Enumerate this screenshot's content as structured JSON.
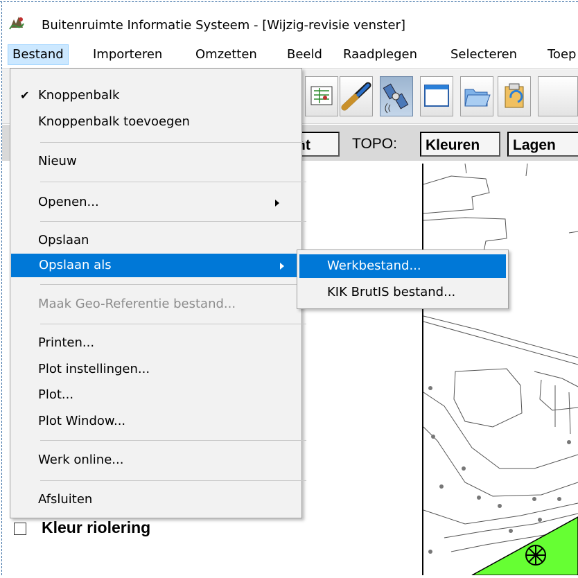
{
  "window": {
    "title": "Buitenruimte Informatie Systeem - [Wijzig-revisie venster]"
  },
  "menubar": {
    "items": [
      {
        "label": "Bestand",
        "active": true
      },
      {
        "label": "Importeren"
      },
      {
        "label": "Omzetten"
      },
      {
        "label": "Beeld"
      },
      {
        "label": "Raadplegen"
      },
      {
        "label": "Selecteren"
      },
      {
        "label": "Toep"
      }
    ]
  },
  "toolbar": {
    "icons": [
      "layers-icon",
      "pipe-icon",
      "satellite-icon",
      "window-icon",
      "open-folder-icon",
      "clipboard-icon"
    ],
    "segment_partial": "nt",
    "topo_label": "TOPO:",
    "kleuren_label": "Kleuren",
    "lagen_label": "Lagen"
  },
  "bestand_menu": {
    "items": [
      {
        "label": "Knoppenbalk",
        "checked": true
      },
      {
        "label": "Knoppenbalk toevoegen"
      },
      {
        "label": "Nieuw"
      },
      {
        "label": "Openen...",
        "submenu": true
      },
      {
        "label": "Opslaan"
      },
      {
        "label": "Opslaan als",
        "submenu": true,
        "highlighted": true
      },
      {
        "label": "Maak Geo-Referentie bestand...",
        "disabled": true
      },
      {
        "label": "Printen..."
      },
      {
        "label": "Plot instellingen..."
      },
      {
        "label": "Plot..."
      },
      {
        "label": "Plot Window..."
      },
      {
        "label": "Werk online..."
      },
      {
        "label": "Afsluiten"
      }
    ]
  },
  "opslaan_als_submenu": {
    "items": [
      {
        "label": "Werkbestand...",
        "highlighted": true
      },
      {
        "label": "KIK BrutIS bestand..."
      }
    ]
  },
  "panel": {
    "checkbox_label": "Kleur riolering",
    "checked": false
  },
  "colors": {
    "highlight": "#0078d7",
    "map_green": "#66ff33",
    "active_menu": "#cce8ff"
  }
}
